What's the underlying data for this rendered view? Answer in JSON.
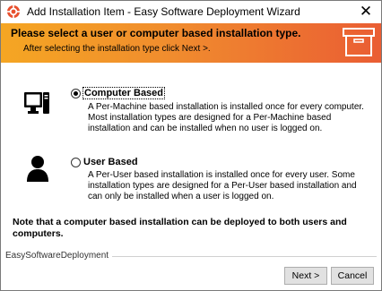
{
  "window": {
    "title": "Add Installation Item - Easy Software Deployment Wizard",
    "close_glyph": "✕"
  },
  "banner": {
    "title": "Please select a user or computer based installation type.",
    "subtitle": "After selecting the installation type click Next >.",
    "gradient_colors": [
      "#f5a623",
      "#ea5d33"
    ],
    "icon": "box-icon"
  },
  "options": [
    {
      "label": "Computer Based",
      "selected": true,
      "icon": "computer-icon",
      "description": "A Per-Machine based installation is installed once for every computer. Most installation types are designed for a Per-Machine based installation and can be installed when no user is logged on."
    },
    {
      "label": "User Based",
      "selected": false,
      "icon": "user-icon",
      "description": "A Per-User based installation is installed once for every user. Some installation types are designed for a Per-User based installation and can only be installed when a user is logged on."
    }
  ],
  "note": "Note that a computer based installation can be deployed to both users and computers.",
  "footer": {
    "brand": "EasySoftwareDeployment",
    "next_label": "Next >",
    "cancel_label": "Cancel"
  }
}
